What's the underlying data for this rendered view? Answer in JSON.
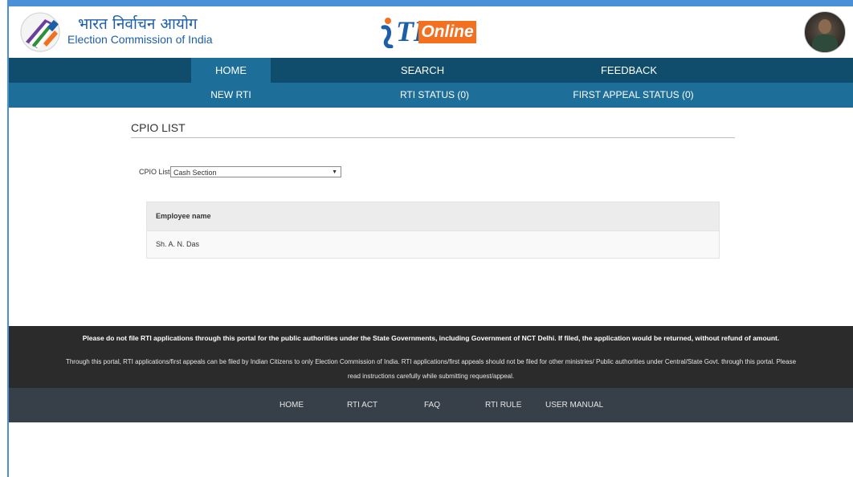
{
  "header": {
    "hindi_title": "भारत निर्वाचन आयोग",
    "english_title": "Election Commission of India",
    "rti_logo_text": "Online",
    "logo_icon": "eci-voting-hand-icon",
    "avatar_icon": "user-avatar"
  },
  "nav_primary": [
    "HOME",
    "SEARCH",
    "FEEDBACK"
  ],
  "nav_secondary": [
    "NEW RTI",
    "RTI STATUS (0)",
    "FIRST APPEAL STATUS (0)"
  ],
  "main": {
    "section_title": "CPIO LIST",
    "cpio_label": "CPIO List:",
    "cpio_selected": "Cash Section",
    "table": {
      "header": "Employee name",
      "rows": [
        "Sh. A. N. Das"
      ]
    }
  },
  "footer": {
    "warning": "Please do not file RTI applications through this portal for the public authorities under the State Governments, including Government of NCT Delhi. If filed, the application would be returned, without refund of amount.",
    "info": "Through this portal, RTI applications/first appeals can be filed by Indian Citizens to only Election Commission of India. RTI applications/first appeals should not be filed for other ministries/ Public authorities under Central/State Govt. through this portal. Please read instructions carefully while submitting request/appeal.",
    "links": [
      "HOME",
      "RTI ACT",
      "FAQ",
      "RTI RULE",
      "USER MANUAL"
    ]
  },
  "colors": {
    "nav_dark": "#104c6c",
    "nav_light": "#1d6f9a",
    "brand_blue": "#1d5ea8",
    "brand_orange": "#f37021",
    "footer_bg": "#2b2b2b",
    "footer_nav_bg": "#374049"
  }
}
